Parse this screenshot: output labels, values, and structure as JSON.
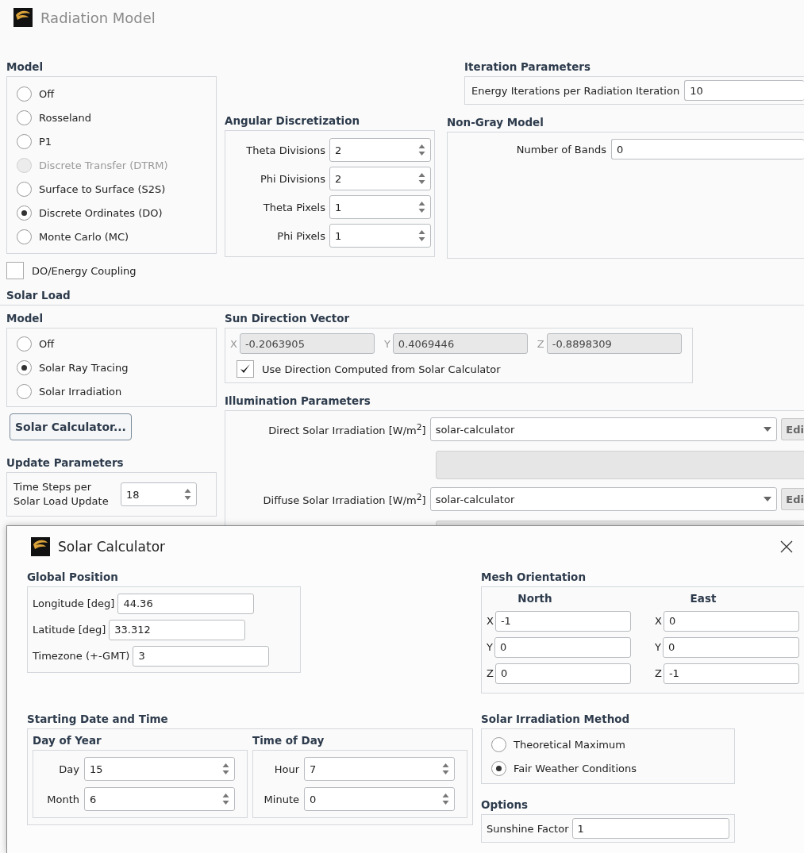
{
  "window": {
    "title": "Radiation Model"
  },
  "model": {
    "heading": "Model",
    "options": [
      {
        "label": "Off",
        "selected": false,
        "disabled": false
      },
      {
        "label": "Rosseland",
        "selected": false,
        "disabled": false
      },
      {
        "label": "P1",
        "selected": false,
        "disabled": false
      },
      {
        "label": "Discrete Transfer (DTRM)",
        "selected": false,
        "disabled": true
      },
      {
        "label": "Surface to Surface (S2S)",
        "selected": false,
        "disabled": false
      },
      {
        "label": "Discrete Ordinates (DO)",
        "selected": true,
        "disabled": false
      },
      {
        "label": "Monte Carlo (MC)",
        "selected": false,
        "disabled": false
      }
    ],
    "coupling": {
      "label": "DO/Energy Coupling",
      "checked": false
    }
  },
  "iteration_parameters": {
    "heading": "Iteration Parameters",
    "label": "Energy Iterations per Radiation Iteration",
    "value": "10"
  },
  "angular_discretization": {
    "heading": "Angular Discretization",
    "fields": [
      {
        "label": "Theta Divisions",
        "value": "2"
      },
      {
        "label": "Phi Divisions",
        "value": "2"
      },
      {
        "label": "Theta Pixels",
        "value": "1"
      },
      {
        "label": "Phi Pixels",
        "value": "1"
      }
    ]
  },
  "non_gray_model": {
    "heading": "Non-Gray Model",
    "label": "Number of Bands",
    "value": "0"
  },
  "solar_load": {
    "heading": "Solar Load",
    "model": {
      "heading": "Model",
      "options": [
        {
          "label": "Off",
          "selected": false
        },
        {
          "label": "Solar Ray Tracing",
          "selected": true
        },
        {
          "label": "Solar Irradiation",
          "selected": false
        }
      ]
    },
    "calculator_button": "Solar Calculator...",
    "update_parameters": {
      "heading": "Update Parameters",
      "label": "Time Steps per Solar Load Update",
      "value": "18"
    },
    "sun_direction_vector": {
      "heading": "Sun Direction Vector",
      "components": [
        {
          "axis": "X",
          "value": "-0.2063905",
          "disabled": true
        },
        {
          "axis": "Y",
          "value": "0.4069446",
          "disabled": true
        },
        {
          "axis": "Z",
          "value": "-0.8898309",
          "disabled": true
        }
      ],
      "use_calculator": {
        "label": "Use Direction Computed from Solar Calculator",
        "checked": true
      }
    },
    "illumination_parameters": {
      "heading": "Illumination Parameters",
      "rows": [
        {
          "label": "Direct Solar Irradiation [W/m$^{2}$]",
          "value": "solar-calculator",
          "button": "Edi"
        },
        {
          "label": "Diffuse Solar Irradiation [W/m$^{2}$]",
          "value": "solar-calculator",
          "button": "Edi"
        }
      ]
    }
  },
  "solar_calculator": {
    "title": "Solar Calculator",
    "global_position": {
      "heading": "Global Position",
      "fields": [
        {
          "label": "Longitude [deg]",
          "value": "44.36"
        },
        {
          "label": "Latitude [deg]",
          "value": "33.312"
        },
        {
          "label": "Timezone (+-GMT)",
          "value": "3"
        }
      ]
    },
    "mesh_orientation": {
      "heading": "Mesh Orientation",
      "columns": [
        {
          "heading": "North",
          "fields": [
            {
              "axis": "X",
              "value": "-1"
            },
            {
              "axis": "Y",
              "value": "0"
            },
            {
              "axis": "Z",
              "value": "0"
            }
          ]
        },
        {
          "heading": "East",
          "fields": [
            {
              "axis": "X",
              "value": "0"
            },
            {
              "axis": "Y",
              "value": "0"
            },
            {
              "axis": "Z",
              "value": "-1"
            }
          ]
        }
      ]
    },
    "starting_date_and_time": {
      "heading": "Starting Date and Time",
      "groups": [
        {
          "heading": "Day of Year",
          "fields": [
            {
              "label": "Day",
              "value": "15"
            },
            {
              "label": "Month",
              "value": "6"
            }
          ]
        },
        {
          "heading": "Time of Day",
          "fields": [
            {
              "label": "Hour",
              "value": "7"
            },
            {
              "label": "Minute",
              "value": "0"
            }
          ]
        }
      ]
    },
    "solar_irradiation_method": {
      "heading": "Solar Irradiation Method",
      "options": [
        {
          "label": "Theoretical Maximum",
          "selected": false
        },
        {
          "label": "Fair Weather Conditions",
          "selected": true
        }
      ]
    },
    "options": {
      "heading": "Options",
      "fields": [
        {
          "label": "Sunshine Factor",
          "value": "1"
        }
      ]
    }
  }
}
